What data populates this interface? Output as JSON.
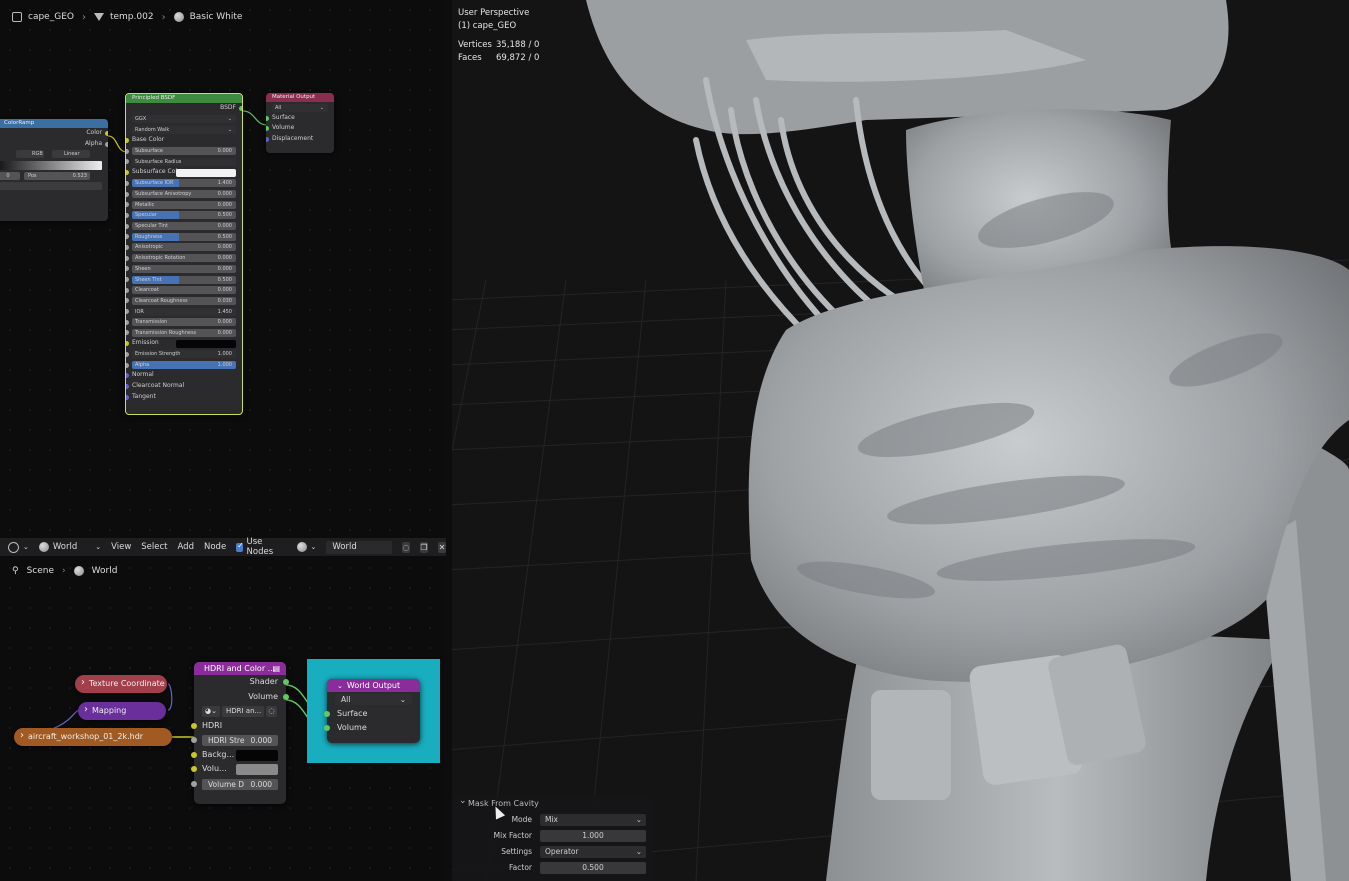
{
  "shader_editor": {
    "header": {
      "object": "cape_GEO",
      "material": "temp.002",
      "world": "Basic White"
    },
    "color_ramp": {
      "title": "ColorRamp",
      "outputs": [
        "Color",
        "Alpha"
      ],
      "mode": "RGB",
      "interp": "Linear",
      "index": "0",
      "pos_label": "Pos",
      "pos_value": "0.523"
    },
    "principled": {
      "title": "Principled BSDF",
      "output": "BSDF",
      "distribution": "GGX",
      "subsurface_method": "Random Walk",
      "rows": [
        {
          "label": "Base Color",
          "value": "",
          "type": "socket"
        },
        {
          "label": "Subsurface",
          "value": "0.000",
          "type": "field"
        },
        {
          "label": "Subsurface Radius",
          "value": "",
          "type": "dropdown"
        },
        {
          "label": "Subsurface Color",
          "value": "",
          "type": "color"
        },
        {
          "label": "Subsurface IOR",
          "value": "1.400",
          "type": "blue"
        },
        {
          "label": "Subsurface Anisotropy",
          "value": "0.000",
          "type": "field"
        },
        {
          "label": "Metallic",
          "value": "0.000",
          "type": "field"
        },
        {
          "label": "Specular",
          "value": "0.500",
          "type": "blue"
        },
        {
          "label": "Specular Tint",
          "value": "0.000",
          "type": "field"
        },
        {
          "label": "Roughness",
          "value": "0.500",
          "type": "blue"
        },
        {
          "label": "Anisotropic",
          "value": "0.000",
          "type": "field"
        },
        {
          "label": "Anisotropic Rotation",
          "value": "0.000",
          "type": "field"
        },
        {
          "label": "Sheen",
          "value": "0.000",
          "type": "field"
        },
        {
          "label": "Sheen Tint",
          "value": "0.500",
          "type": "blue"
        },
        {
          "label": "Clearcoat",
          "value": "0.000",
          "type": "field"
        },
        {
          "label": "Clearcoat Roughness",
          "value": "0.030",
          "type": "field"
        },
        {
          "label": "IOR",
          "value": "1.450",
          "type": "dark"
        },
        {
          "label": "Transmission",
          "value": "0.000",
          "type": "field"
        },
        {
          "label": "Transmission Roughness",
          "value": "0.000",
          "type": "field"
        },
        {
          "label": "Emission",
          "value": "",
          "type": "black"
        },
        {
          "label": "Emission Strength",
          "value": "1.000",
          "type": "dark"
        },
        {
          "label": "Alpha",
          "value": "1.000",
          "type": "fullblue"
        },
        {
          "label": "Normal",
          "value": "",
          "type": "socket"
        },
        {
          "label": "Clearcoat Normal",
          "value": "",
          "type": "socket"
        },
        {
          "label": "Tangent",
          "value": "",
          "type": "socket"
        }
      ]
    },
    "material_output": {
      "title": "Material Output",
      "target": "All",
      "inputs": [
        "Surface",
        "Volume",
        "Displacement"
      ]
    }
  },
  "world_editor": {
    "toolbar": {
      "type": "World",
      "menus": [
        "View",
        "Select",
        "Add",
        "Node"
      ],
      "use_nodes": "Use Nodes",
      "world_name": "World"
    },
    "breadcrumb": [
      "Scene",
      "World"
    ],
    "pills": {
      "texture_coordinate": "Texture Coordinate",
      "mapping": "Mapping",
      "hdri_file": "aircraft_workshop_01_2k.hdr"
    },
    "hdri_node": {
      "title": "HDRI and Color ...",
      "outputs": [
        "Shader",
        "Volume"
      ],
      "selector": "HDRI an...",
      "hdri_label": "HDRI",
      "hdri_strength_label": "HDRI Stre",
      "hdri_strength": "0.000",
      "background_label": "Backg...",
      "volume_label": "Volu...",
      "volume_d_label": "Volume D",
      "volume_d": "0.000"
    },
    "world_output": {
      "title": "World Output",
      "target": "All",
      "inputs": [
        "Surface",
        "Volume"
      ]
    }
  },
  "viewport": {
    "view": "User Perspective",
    "object": "(1) cape_GEO",
    "stats": {
      "vertices_label": "Vertices",
      "vertices": "35,188 / 0",
      "faces_label": "Faces",
      "faces": "69,872 / 0"
    },
    "redo_panel": {
      "title": "Mask From Cavity",
      "mode_label": "Mode",
      "mode": "Mix",
      "mix_factor_label": "Mix Factor",
      "mix_factor": "1.000",
      "settings_label": "Settings",
      "settings": "Operator",
      "factor_label": "Factor",
      "factor": "0.500"
    }
  },
  "colors": {
    "principled_border": "#c8e05a",
    "world_output_highlight": "#19aebf",
    "shader_socket": "#63c763",
    "color_socket": "#c7c729"
  }
}
